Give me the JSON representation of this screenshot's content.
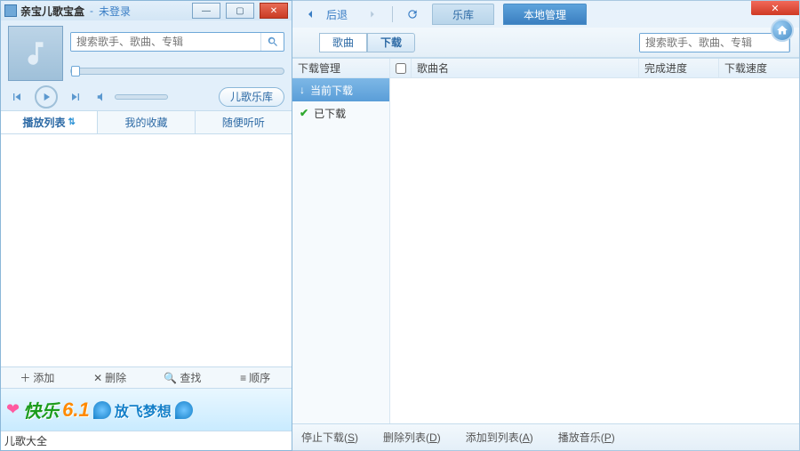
{
  "left": {
    "title_app": "亲宝儿歌宝盒",
    "title_sep": " - ",
    "title_status": "未登录",
    "search_placeholder": "搜索歌手、歌曲、专辑",
    "lib_button": "儿歌乐库",
    "tabs": [
      "播放列表",
      "我的收藏",
      "随便听听"
    ],
    "actions": {
      "add": "添加",
      "delete": "删除",
      "find": "查找",
      "order": "顺序"
    },
    "banner": {
      "b1": "快乐",
      "b2": "6.1",
      "b3": "放飞梦想"
    },
    "bottom_link": "儿歌大全"
  },
  "right": {
    "back_label": "后退",
    "bigtabs": [
      "乐库",
      "本地管理"
    ],
    "subtabs": [
      "歌曲",
      "下载"
    ],
    "search_placeholder": "搜索歌手、歌曲、专辑",
    "side_head": "下载管理",
    "side_items": [
      "当前下载",
      "已下载"
    ],
    "columns": {
      "name": "歌曲名",
      "progress": "完成进度",
      "speed": "下载速度"
    },
    "footer": {
      "stop": "停止下载",
      "stop_k": "S",
      "delete": "删除列表",
      "delete_k": "D",
      "addto": "添加到列表",
      "addto_k": "A",
      "play": "播放音乐",
      "play_k": "P"
    }
  }
}
